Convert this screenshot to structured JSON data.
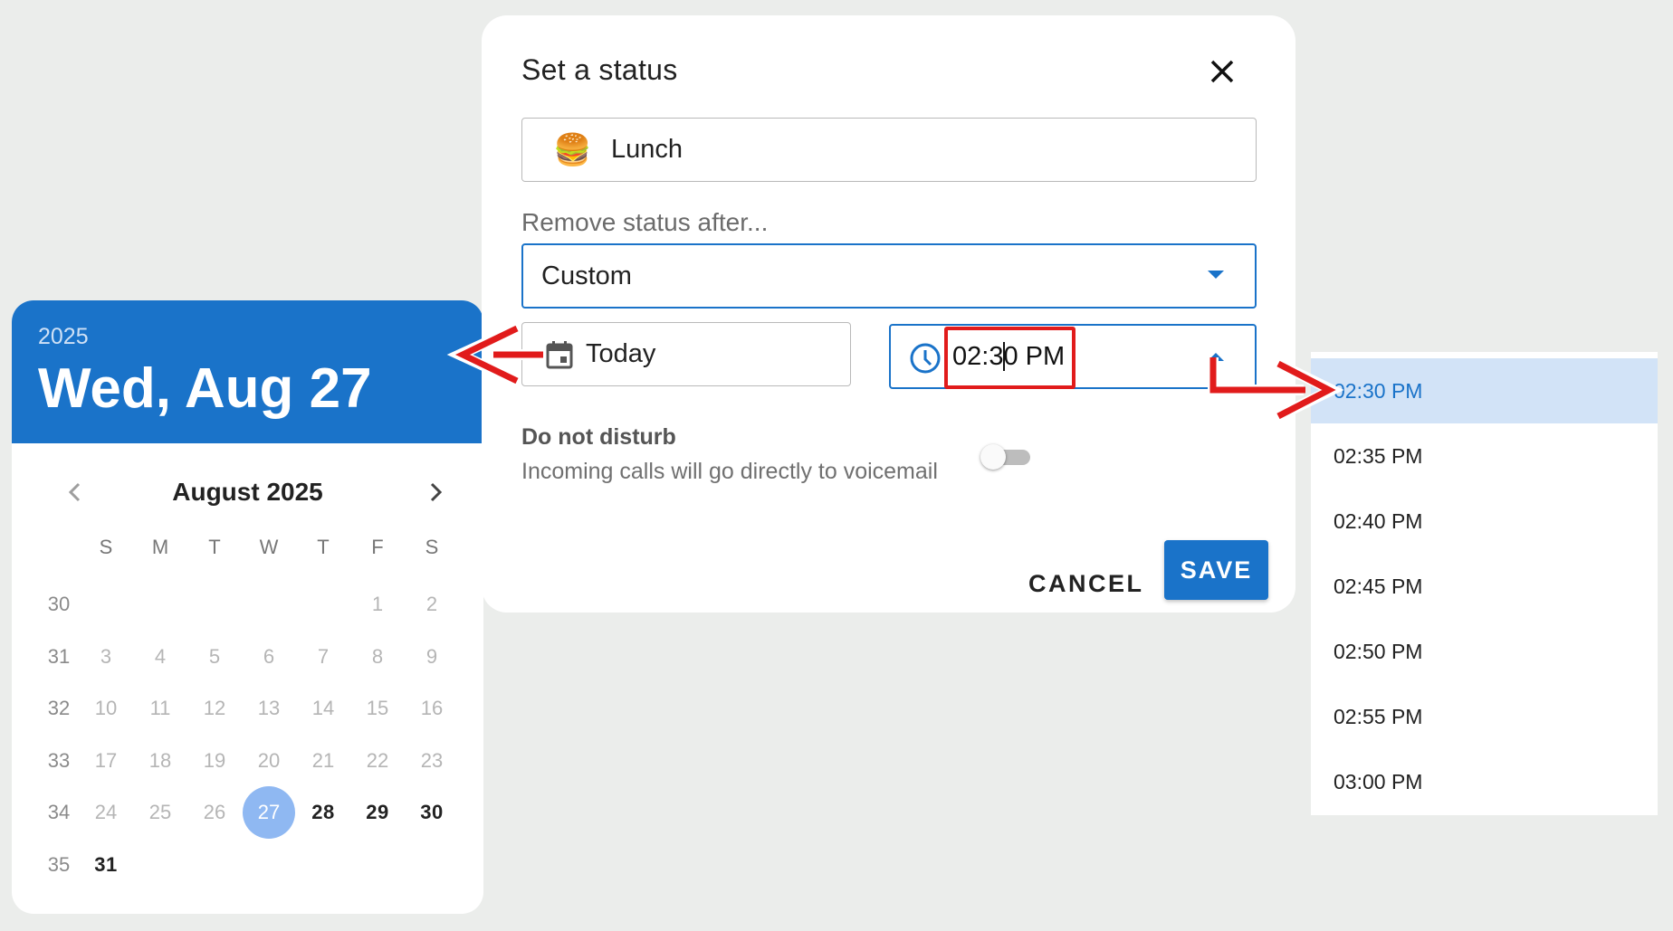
{
  "dialog": {
    "title": "Set a status",
    "close_icon": "close-icon",
    "status_emoji": "🍔",
    "status_text": "Lunch",
    "remove_label": "Remove status after...",
    "remove_value": "Custom",
    "date_value": "Today",
    "time_value": "02:30 PM",
    "dnd_title": "Do not disturb",
    "dnd_subtitle": "Incoming calls will go directly to voicemail",
    "dnd_enabled": false,
    "cancel_label": "CANCEL",
    "save_label": "SAVE",
    "accent_color": "#1a73c9"
  },
  "calendar": {
    "year": "2025",
    "selected_date": "Wed, Aug 27",
    "month_label": "August 2025",
    "weekdays": [
      "S",
      "M",
      "T",
      "W",
      "T",
      "F",
      "S"
    ],
    "weeks": [
      {
        "week": "30",
        "days": [
          "",
          "",
          "",
          "",
          "",
          "1",
          "2"
        ]
      },
      {
        "week": "31",
        "days": [
          "3",
          "4",
          "5",
          "6",
          "7",
          "8",
          "9"
        ]
      },
      {
        "week": "32",
        "days": [
          "10",
          "11",
          "12",
          "13",
          "14",
          "15",
          "16"
        ]
      },
      {
        "week": "33",
        "days": [
          "17",
          "18",
          "19",
          "20",
          "21",
          "22",
          "23"
        ]
      },
      {
        "week": "34",
        "days": [
          "24",
          "25",
          "26",
          "27",
          "28",
          "29",
          "30"
        ]
      },
      {
        "week": "35",
        "days": [
          "31",
          "",
          "",
          "",
          "",
          "",
          ""
        ]
      }
    ],
    "selected_day": "27",
    "enabled_days": [
      "27",
      "28",
      "29",
      "30",
      "31"
    ]
  },
  "time_options": [
    "02:30 PM",
    "02:35 PM",
    "02:40 PM",
    "02:45 PM",
    "02:50 PM",
    "02:55 PM",
    "03:00 PM"
  ],
  "time_selected": "02:30 PM",
  "annotation_color": "#e11b1b"
}
